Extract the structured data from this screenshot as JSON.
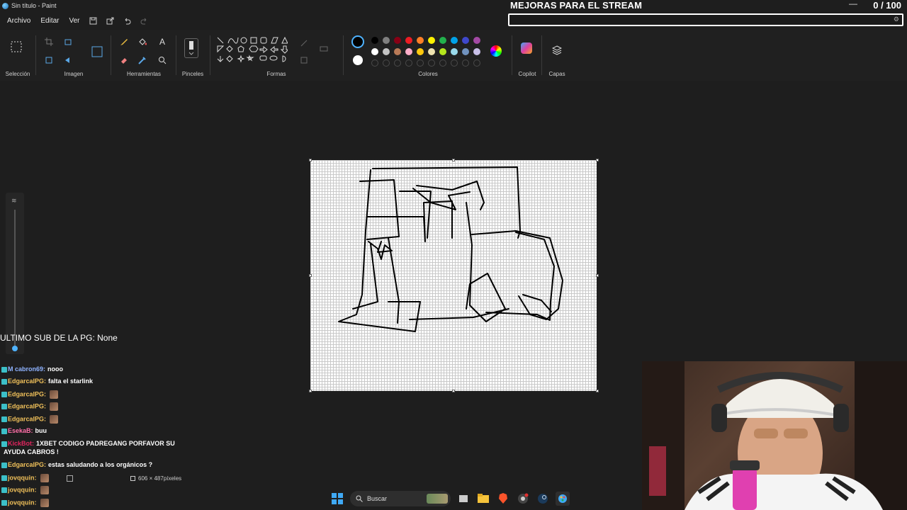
{
  "window": {
    "title": "Sin título - Paint"
  },
  "menu": {
    "items": [
      "Archivo",
      "Editar",
      "Ver"
    ]
  },
  "ribbon": {
    "groups": {
      "seleccion": "Selección",
      "imagen": "Imagen",
      "herramientas": "Herramientas",
      "pinceles": "Pinceles",
      "formas": "Formas",
      "colores": "Colores",
      "copilot": "Copilot",
      "capas": "Capas"
    },
    "colors": {
      "primary": "#000000",
      "secondary": "#ffffff",
      "palette_row1": [
        "#000000",
        "#7f7f7f",
        "#880015",
        "#ed1c24",
        "#ff7f27",
        "#fff200",
        "#22b14c",
        "#00a2e8",
        "#3f48cc",
        "#a349a4"
      ],
      "palette_row2": [
        "#ffffff",
        "#c3c3c3",
        "#b97a57",
        "#ffaec9",
        "#ffc90e",
        "#efe4b0",
        "#b5e61d",
        "#99d9ea",
        "#7092be",
        "#c8bfe7"
      ]
    }
  },
  "stream_overlay": {
    "goal_title": "MEJORAS PARA EL STREAM",
    "goal_current": "0",
    "goal_total": "/ 100",
    "last_sub": "ULTIMO SUB DE LA PG: None"
  },
  "chat": [
    {
      "user": "M cabron69:",
      "user_color": "#8fb3ff",
      "message": "nooo",
      "emote": false
    },
    {
      "user": "EdgarcalPG:",
      "user_color": "#f0c05a",
      "message": "falta el starlink",
      "emote": false
    },
    {
      "user": "EdgarcalPG:",
      "user_color": "#f0c05a",
      "message": "",
      "emote": true
    },
    {
      "user": "EdgarcalPG:",
      "user_color": "#f0c05a",
      "message": "",
      "emote": true
    },
    {
      "user": "EdgarcalPG:",
      "user_color": "#f0c05a",
      "message": "",
      "emote": true
    },
    {
      "user": "EsekaB:",
      "user_color": "#ff6fa8",
      "message": "buu",
      "emote": false
    },
    {
      "user": "KickBot:",
      "user_color": "#e0245e",
      "message": "1XBET CODIGO PADREGANG PORFAVOR SU",
      "emote": false
    },
    {
      "user": "",
      "user_color": "#ffffff",
      "message": "AYUDA CABROS !",
      "emote": false
    },
    {
      "user": "EdgarcalPG:",
      "user_color": "#f0c05a",
      "message": "estas saludando a los orgánicos ?",
      "emote": false
    },
    {
      "user": "jovqquin:",
      "user_color": "#f0c05a",
      "message": "",
      "emote": true
    },
    {
      "user": "jovqquin:",
      "user_color": "#f0c05a",
      "message": "",
      "emote": true
    },
    {
      "user": "jovqquin:",
      "user_color": "#f0c05a",
      "message": "",
      "emote": true
    }
  ],
  "statusbar": {
    "canvas_size": "606 × 487píxeles"
  },
  "taskbar": {
    "search_label": "Buscar"
  }
}
